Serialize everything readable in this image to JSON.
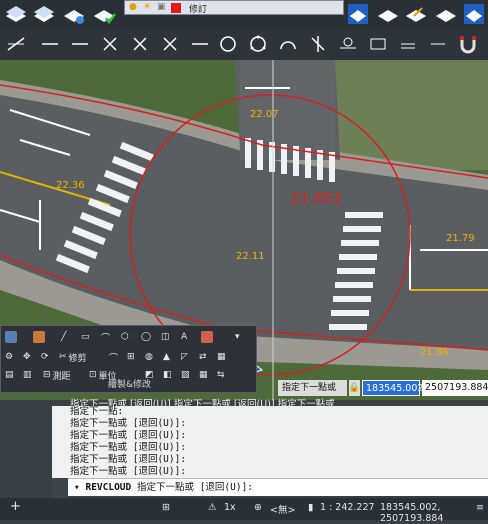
{
  "layer_control": {
    "layer_name": "修訂",
    "color_hex": "#e01b1b"
  },
  "dimension_labels": [
    {
      "text": "22.36",
      "color": "#f0b000"
    },
    {
      "text": "22.11",
      "color": "#f0b000"
    },
    {
      "text": "21.79",
      "color": "#f0b000"
    },
    {
      "text": "21.86",
      "color": "#f0b000"
    },
    {
      "text": "21.852",
      "color": "#e02020"
    },
    {
      "text": "22.07",
      "color": "#f0b000"
    }
  ],
  "floating_panel": {
    "row2": {
      "modify_label": "修剪"
    },
    "row3": {
      "measure_label": "測距",
      "unit_label": "單位"
    },
    "title": "繪製&修改"
  },
  "coordinate_input": {
    "prompt": "指定下一點或",
    "lock_glyph": "🔒",
    "x_value": "183545.002",
    "y_value": "2507193.884"
  },
  "overflow_text": "指定下一點或 [返回(U)] 指定下一點或 [返回(U)] 指定下一點或",
  "command_history": [
    "指定下一點:",
    "指定下一點或 [退回(U)]:",
    "指定下一點或 [退回(U)]:",
    "指定下一點或 [退回(U)]:",
    "指定下一點或 [退回(U)]:",
    "指定下一點或 [退回(U)]:"
  ],
  "command_line": {
    "command": "REVCLOUD",
    "prompt": "指定下一點或 [退回(U)]:"
  },
  "status_bar": {
    "add_glyph": "+",
    "grid_glyph": "⊞",
    "scale_label": "1x",
    "none_label": "<無>",
    "ratio_label": "1 : 242.227",
    "coords": "183545.002, 2507193.884",
    "menu_glyph": "≡"
  },
  "colors": {
    "revision_cloud": "#d61f1f",
    "road": "#5b5e60",
    "lane_marking": "#ffffff",
    "yellow_line": "#e0b400",
    "accent_blue": "#2a6fd6"
  }
}
